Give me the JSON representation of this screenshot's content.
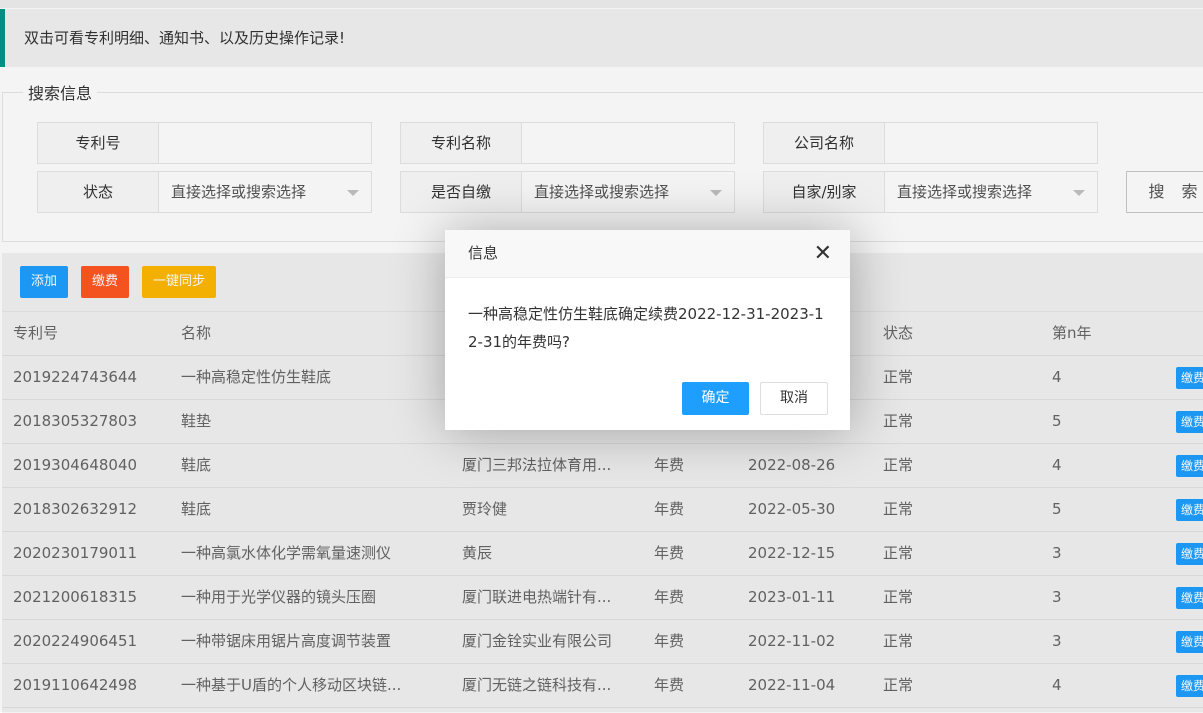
{
  "notice": "双击可看专利明细、通知书、以及历史操作记录!",
  "search": {
    "legend": "搜索信息",
    "fields": {
      "patent_no": {
        "label": "专利号",
        "value": ""
      },
      "patent_name": {
        "label": "专利名称",
        "value": ""
      },
      "company": {
        "label": "公司名称",
        "value": ""
      },
      "status": {
        "label": "状态",
        "value": "直接选择或搜索选择"
      },
      "self_pay": {
        "label": "是否自缴",
        "value": "直接选择或搜索选择"
      },
      "own_other": {
        "label": "自家/别家",
        "value": "直接选择或搜索选择"
      }
    },
    "search_button": "搜 索"
  },
  "toolbar": {
    "add": "添加",
    "pay": "缴费",
    "sync": "一键同步"
  },
  "colors": {
    "add": "#1e9fff",
    "pay": "#ff5722",
    "sync": "#ffb800",
    "notice_accent": "#009688"
  },
  "table": {
    "headers": {
      "patent_no": "专利号",
      "name": "名称",
      "status": "状态",
      "year": "第n年"
    },
    "rows": [
      {
        "patent_no": "2019224743644",
        "name": "一种高稳定性仿生鞋底",
        "owner": "",
        "fee": "",
        "date": "",
        "status": "正常",
        "year": "4",
        "action": "缴费"
      },
      {
        "patent_no": "2018305327803",
        "name": "鞋垫",
        "owner": "",
        "fee": "",
        "date": "",
        "status": "正常",
        "year": "5",
        "action": "缴费"
      },
      {
        "patent_no": "2019304648040",
        "name": "鞋底",
        "owner": "厦门三邦法拉体育用...",
        "fee": "年费",
        "date": "2022-08-26",
        "status": "正常",
        "year": "4",
        "action": "缴费"
      },
      {
        "patent_no": "2018302632912",
        "name": "鞋底",
        "owner": "贾玲健",
        "fee": "年费",
        "date": "2022-05-30",
        "status": "正常",
        "year": "5",
        "action": "缴费"
      },
      {
        "patent_no": "2020230179011",
        "name": "一种高氯水体化学需氧量速测仪",
        "owner": "黄辰",
        "fee": "年费",
        "date": "2022-12-15",
        "status": "正常",
        "year": "3",
        "action": "缴费"
      },
      {
        "patent_no": "2021200618315",
        "name": "一种用于光学仪器的镜头压圈",
        "owner": "厦门联进电热端针有...",
        "fee": "年费",
        "date": "2023-01-11",
        "status": "正常",
        "year": "3",
        "action": "缴费"
      },
      {
        "patent_no": "2020224906451",
        "name": "一种带锯床用锯片高度调节装置",
        "owner": "厦门金铨实业有限公司",
        "fee": "年费",
        "date": "2022-11-02",
        "status": "正常",
        "year": "3",
        "action": "缴费"
      },
      {
        "patent_no": "2019110642498",
        "name": "一种基于U盾的个人移动区块链...",
        "owner": "厦门无链之链科技有...",
        "fee": "年费",
        "date": "2022-11-04",
        "status": "正常",
        "year": "4",
        "action": "缴费"
      }
    ]
  },
  "dialog": {
    "title": "信息",
    "close_icon": "close-icon",
    "message": "一种高稳定性仿生鞋底确定续费2022-12-31-2023-12-31的年费吗?",
    "confirm": "确定",
    "cancel": "取消"
  }
}
